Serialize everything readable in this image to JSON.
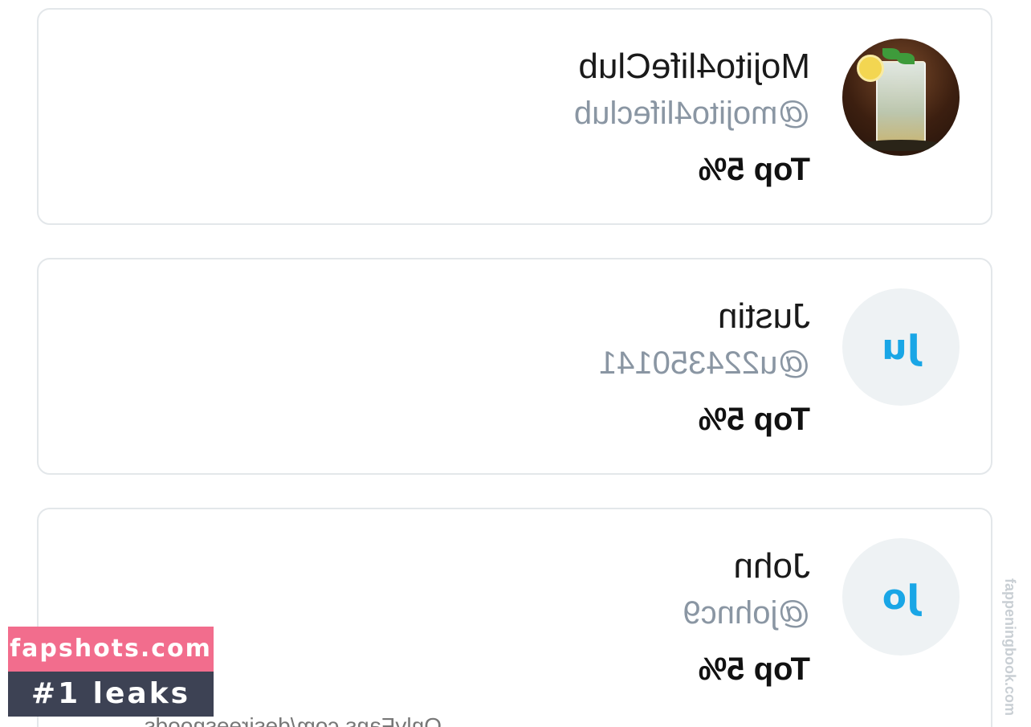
{
  "users": [
    {
      "name": "Mojito4lifeClub",
      "handle": "@mojito4lifeclub",
      "rank": "Top 5%",
      "avatar_type": "photo",
      "initials": ""
    },
    {
      "name": "Justin",
      "handle": "@u224350141",
      "rank": "Top 5%",
      "avatar_type": "initials",
      "initials": "Ju"
    },
    {
      "name": "John",
      "handle": "@johnc9",
      "rank": "Top 5%",
      "avatar_type": "initials",
      "initials": "Jo"
    }
  ],
  "footer": {
    "url": "OnlyFans.com/desireesnoods"
  },
  "watermark": {
    "site": "fapshots.com",
    "tagline": "#1 leaks",
    "side_text": "fappeningbook.com"
  },
  "colors": {
    "initials": "#19a6e6",
    "handle": "#8a96a3",
    "badge_pink": "#f26d8d",
    "badge_dark": "#3d4254"
  }
}
